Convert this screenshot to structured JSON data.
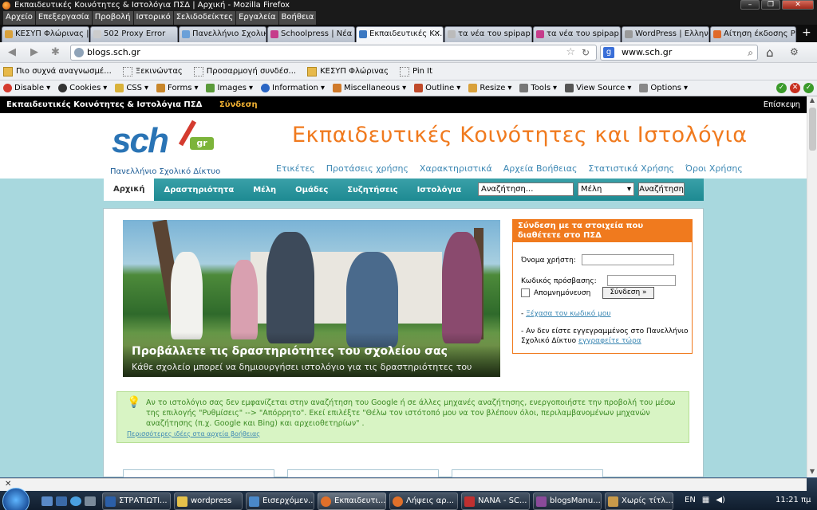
{
  "window": {
    "title": "Εκπαιδευτικές Κοινότητες & Ιστολόγια ΠΣΔ | Αρχική - Mozilla Firefox"
  },
  "menu": [
    "Αρχείο",
    "Επεξεργασία",
    "Προβολή",
    "Ιστορικό",
    "Σελιδοδείκτες",
    "Εργαλεία",
    "Βοήθεια"
  ],
  "tabs": [
    {
      "label": "ΚΕΣΥΠ Φλώρινας | ...",
      "color": "#d9a13b"
    },
    {
      "label": "502 Proxy Error",
      "color": "#cccccc"
    },
    {
      "label": "Πανελλήνιο Σχολικ...",
      "color": "#6aa0d8"
    },
    {
      "label": "Schoolpress | Νέα Υ...",
      "color": "#c63c8b"
    },
    {
      "label": "Εκπαιδευτικές Κ...",
      "color": "#3a78c2"
    },
    {
      "label": "τα νέα του spipap ...",
      "color": "#bbbbbb"
    },
    {
      "label": "τα νέα του spipap |...",
      "color": "#c63c8b"
    },
    {
      "label": "WordPress | Ελληνικά",
      "color": "#9a9a9a"
    },
    {
      "label": "Αίτηση έκδοσης PIN",
      "color": "#e06a2a"
    }
  ],
  "nav": {
    "url": "blogs.sch.gr",
    "search_value": "www.sch.gr"
  },
  "bookmarks": [
    "Πιο συχνά αναγνωσμέ...",
    "Ξεκινώντας",
    "Προσαρμογή συνδέσ...",
    "ΚΕΣΥΠ Φλώρινας",
    "Pin It"
  ],
  "webdev": [
    "Disable",
    "Cookies",
    "CSS",
    "Forms",
    "Images",
    "Information",
    "Miscellaneous",
    "Outline",
    "Resize",
    "Tools",
    "View Source",
    "Options"
  ],
  "site": {
    "topstrip_title": "Εκπαιδευτικές Κοινότητες & Ιστολόγια ΠΣΔ",
    "topstrip_login": "Σύνδεση",
    "topstrip_visit": "Επίσκεψη",
    "logo_text": "sch",
    "logo_badge": "gr",
    "logo_sub": "Πανελλήνιο Σχολικό Δίκτυο",
    "title": "Εκπαιδευτικές  Κοινότητες και Ιστολόγια",
    "sublinks": [
      "Ετικέτες",
      "Προτάσεις χρήσης",
      "Χαρακτηριστικά",
      "Αρχεία Βοήθειας",
      "Στατιστικά Χρήσης",
      "Όροι Χρήσης"
    ],
    "navitems": [
      "Αρχική",
      "Δραστηριότητα",
      "Μέλη",
      "Ομάδες",
      "Συζητήσεις",
      "Ιστολόγια"
    ],
    "search_placeholder": "Αναζήτηση...",
    "search_scope": "Μέλη",
    "search_button": "Αναζήτηση",
    "hero_title": "Προβάλλετε τις δραστηριότητες του σχολείου σας",
    "hero_sub": "Κάθε σχολείο μπορεί να δημιουργήσει ιστολόγιο για τις δραστηριότητες του",
    "login_header": "Σύνδεση με τα στοιχεία που διαθέτετε στο ΠΣΔ",
    "username_label": "Όνομα χρήστη:",
    "password_label": "Κωδικός πρόσβασης:",
    "remember_label": "Απομνημόνευση",
    "login_button": "Σύνδεση »",
    "forgot_prefix": "- ",
    "forgot_link": "Ξέχασα τον κωδικό μου",
    "register_text": "- Αν δεν είστε εγγεγραμμένος στο Πανελλήνιο Σχολικό Δίκτυο",
    "register_link": "εγγραφείτε τώρα",
    "tip_text": "Αν το ιστολόγιο σας δεν εμφανίζεται στην αναζήτηση του Google ή σε άλλες μηχανές αναζήτησης, ενεργοποιήστε την προβολή του μέσω της επιλογής \"Ρυθμίσεις\" --> \"Απόρρητο\". Εκεί επιλέξτε \"Θέλω τον ιστότοπό μου να τον βλέπουν όλοι, περιλαμβανομένων μηχανών αναζήτησης (π.χ. Google και Bing) και αρχειοθετηρίων\" .",
    "tip_more": "Περισσότερες ιδέες στα αρχεία βοήθειας"
  },
  "taskbar": {
    "items": [
      {
        "label": "ΣΤΡΑΤΙΩΤΙ...",
        "color": "#2b5fa8"
      },
      {
        "label": "wordpress",
        "color": "#e5c14a"
      },
      {
        "label": "Εισερχόμεν...",
        "color": "#4a88c8"
      },
      {
        "label": "Εκπαιδευτι...",
        "color": "#e0702a"
      },
      {
        "label": "Λήψεις αρ...",
        "color": "#e0702a"
      },
      {
        "label": "NANA - SC...",
        "color": "#c03030"
      },
      {
        "label": "blogsManu...",
        "color": "#8a4a9a"
      },
      {
        "label": "Χωρίς τίτλ...",
        "color": "#c89a4a"
      }
    ],
    "lang": "EN",
    "clock": "11:21 πμ"
  }
}
